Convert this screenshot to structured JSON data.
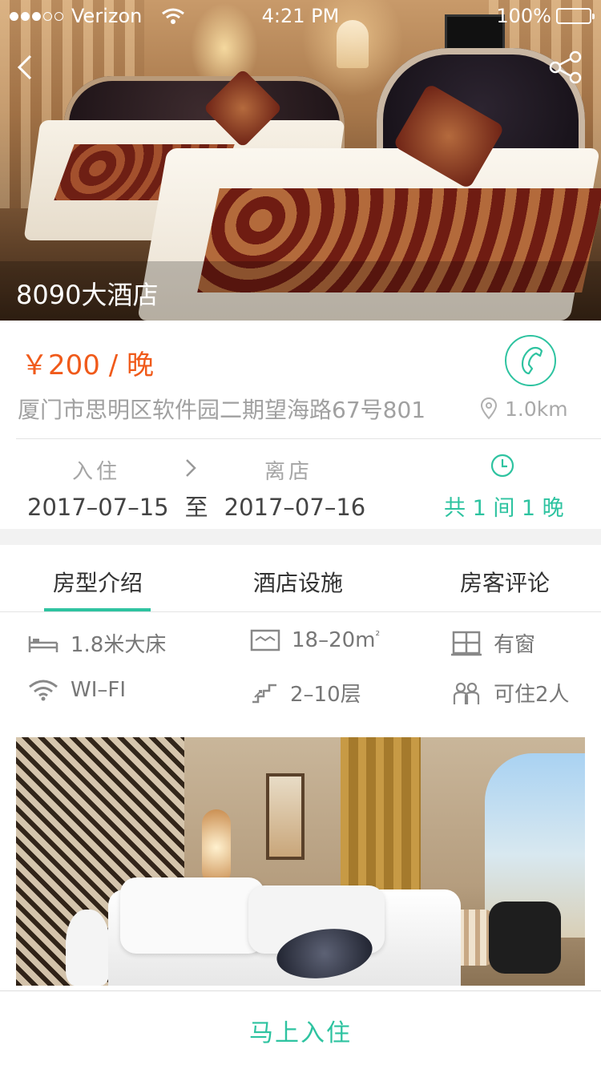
{
  "colors": {
    "accent": "#2ec3a0",
    "price": "#f05a1a",
    "muted_text": "#a0a0a0",
    "divider": "#e4e4e4"
  },
  "status_bar": {
    "carrier": "Verizon",
    "time": "4:21 PM",
    "battery": "100%",
    "signal_bars_filled": 3,
    "signal_bars_total": 5
  },
  "nav": {
    "back_icon": "chevron-left-icon",
    "share_icon": "share-icon"
  },
  "hero": {
    "hotel_name": "8090大酒店"
  },
  "info": {
    "price": "￥200 / 晚",
    "phone_icon": "phone-icon",
    "address": "厦门市思明区软件园二期望海路67号801",
    "distance": "1.0km"
  },
  "stay": {
    "checkin_label": "入住",
    "checkout_label": "离店",
    "checkin_date": "2017–07–15",
    "separator": "至",
    "checkout_date": "2017–07–16",
    "summary": "共 1 间 1 晚"
  },
  "tabs": [
    {
      "label": "房型介绍",
      "active": true
    },
    {
      "label": "酒店设施",
      "active": false
    },
    {
      "label": "房客评论",
      "active": false
    }
  ],
  "facilities": [
    {
      "icon": "bed-icon",
      "label": "1.8米大床"
    },
    {
      "icon": "area-icon",
      "label": "18–20m",
      "suffix": "²"
    },
    {
      "icon": "window-icon",
      "label": "有窗"
    },
    {
      "icon": "wifi-icon",
      "label": "WI–FI"
    },
    {
      "icon": "stairs-icon",
      "label": "2–10层"
    },
    {
      "icon": "guests-icon",
      "label": "可住2人"
    }
  ],
  "cta": {
    "label": "马上入住"
  }
}
